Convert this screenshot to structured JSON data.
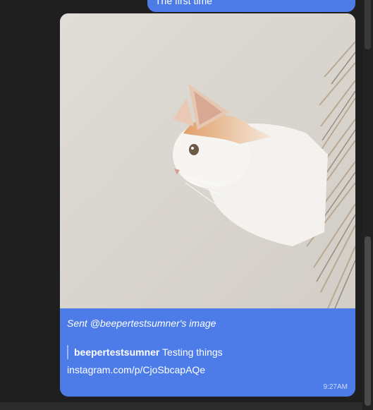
{
  "previous_message": {
    "text": "The first time"
  },
  "message": {
    "image": {
      "subject": "cat"
    },
    "caption": "Sent @beepertestsumner's image",
    "quote": {
      "author": "beepertestsumner",
      "text": "Testing things"
    },
    "link": "instagram.com/p/CjoSbcapAQe",
    "timestamp": "9:27AM"
  },
  "colors": {
    "bubble": "#4d7ce8",
    "background": "#1f1f1f"
  }
}
